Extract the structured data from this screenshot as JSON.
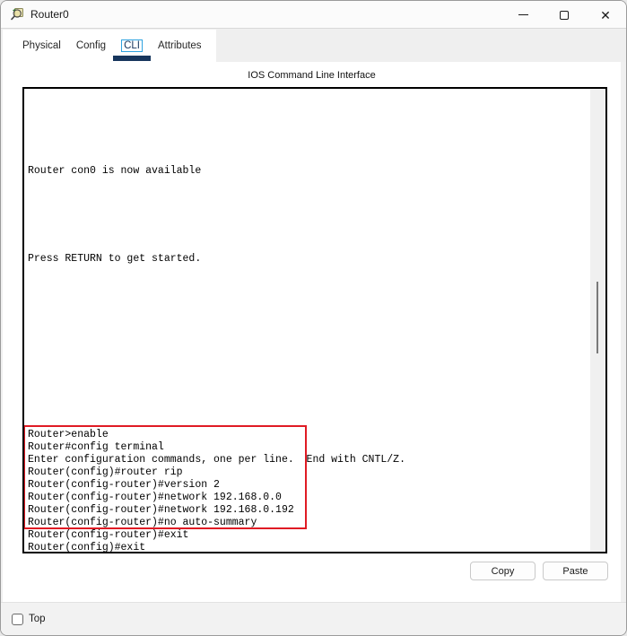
{
  "window": {
    "title": "Router0",
    "controls": {
      "minimize": "minimize",
      "maximize": "maximize",
      "close": "✕"
    }
  },
  "tabs": [
    {
      "label": "Physical",
      "selected": false
    },
    {
      "label": "Config",
      "selected": false
    },
    {
      "label": "CLI",
      "selected": true
    },
    {
      "label": "Attributes",
      "selected": false
    }
  ],
  "cli_panel": {
    "header": "IOS Command Line Interface"
  },
  "terminal": {
    "lines": [
      "",
      "",
      "",
      "",
      "",
      "",
      "Router con0 is now available",
      "",
      "",
      "",
      "",
      "",
      "",
      "Press RETURN to get started.",
      "",
      "",
      "",
      "",
      "",
      "",
      "",
      "",
      "",
      "",
      "",
      "",
      "",
      "Router>enable",
      "Router#config terminal",
      "Enter configuration commands, one per line.  End with CNTL/Z.",
      "Router(config)#router rip",
      "Router(config-router)#version 2",
      "Router(config-router)#network 192.168.0.0",
      "Router(config-router)#network 192.168.0.192",
      "Router(config-router)#no auto-summary",
      "Router(config-router)#exit",
      "Router(config)#exit"
    ],
    "highlighted_commands": [
      "Router>enable",
      "Router#config terminal",
      "Enter configuration commands, one per line.",
      "Router(config)#router rip",
      "Router(config-router)#version 2",
      "Router(config-router)#network 192.168.0.0",
      "Router(config-router)#network 192.168.0.192",
      "Router(config-router)#no auto-summary"
    ]
  },
  "buttons": {
    "copy": "Copy",
    "paste": "Paste"
  },
  "bottom": {
    "top_label": "Top",
    "top_checked": false
  },
  "colors": {
    "tab_underline": "#17365d",
    "tab_focus_outline": "#2fa3e0",
    "annotation_red": "#e01b24",
    "terminal_border": "#000000",
    "scrollbar_thumb": "#7a7a7a"
  }
}
